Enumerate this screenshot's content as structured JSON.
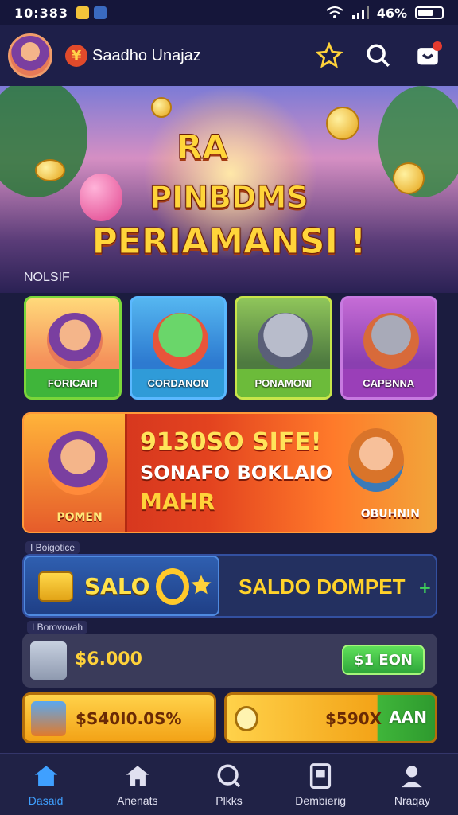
{
  "status_bar": {
    "time": "10:383",
    "battery": "46%"
  },
  "header": {
    "title": "Saadho Unajaz"
  },
  "hero": {
    "badge": "RA",
    "line1": "PINBDMS",
    "line2": "PERIAMANSI !"
  },
  "section_label": "NOLSIF",
  "game_cards": [
    {
      "label": "FORICAIH",
      "icon": "character-fox"
    },
    {
      "label": "CORDANON",
      "icon": "character-dino"
    },
    {
      "label": "PONAMONI",
      "icon": "character-wolf"
    },
    {
      "label": "CAPBNNA",
      "icon": "character-raccoon"
    }
  ],
  "promo": {
    "line1": "9130SO SIFE!",
    "line2": "SONAFO BOKLAIO",
    "line3": "MAHR",
    "left_label": "POMEN",
    "right_label": "OBUHNIN"
  },
  "balance_section": {
    "label": "I Boigotice",
    "left_text": "SALO",
    "right_text": "SALDO DOMPET",
    "plus": "+"
  },
  "list_section": {
    "label": "I Borovovah",
    "row1_amount": "$6.000",
    "row1_button": "$1 EON",
    "row2_amount": "$S40I0.0S%",
    "row3_amount": "$590X",
    "row3_button": "AAN"
  },
  "bottom_nav": [
    {
      "label": "Dasaid",
      "icon": "home-icon",
      "active": true
    },
    {
      "label": "Anenats",
      "icon": "house-icon",
      "active": false
    },
    {
      "label": "Plkks",
      "icon": "search-icon",
      "active": false
    },
    {
      "label": "Dembierig",
      "icon": "tablet-icon",
      "active": false
    },
    {
      "label": "Nraqay",
      "icon": "profile-icon",
      "active": false
    }
  ],
  "colors": {
    "accent": "#3fa0ff",
    "background": "#1b1c3f",
    "coin": "#ffd23a"
  }
}
